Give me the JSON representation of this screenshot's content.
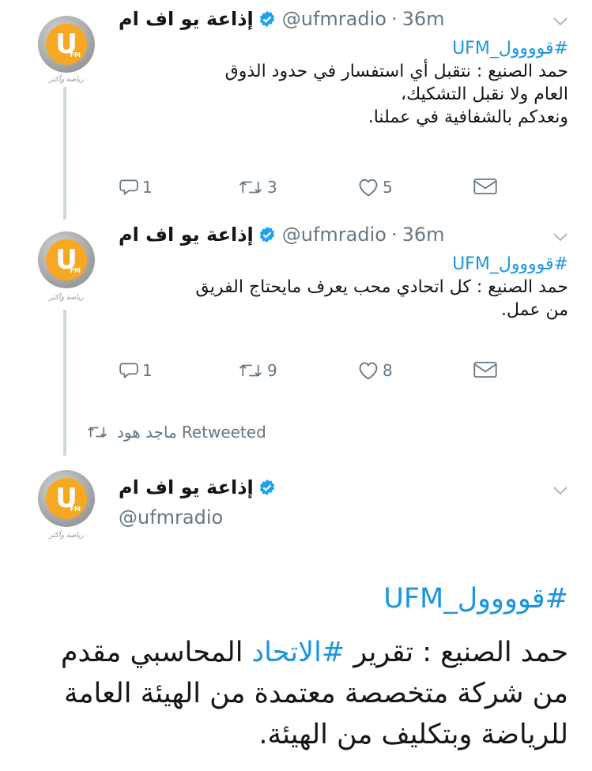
{
  "colors": {
    "accent": "#1b95e0",
    "text": "#14171a",
    "muted": "#657786",
    "line": "#ccd6dd",
    "logo": "#f7a823"
  },
  "account": {
    "name": "إذاعة يو اف ام",
    "handle": "@ufmradio",
    "avatar_letter": "U",
    "avatar_sub": "FM",
    "avatar_caption": "رياضة وأكثر"
  },
  "tweets": [
    {
      "time": "36m",
      "hashtag": "#قوووول_UFM",
      "lines": [
        "حمد الصنيع : نتقبل أي استفسار في حدود الذوق",
        "العام ولا نقبل التشكيك،",
        "ونعدكم بالشفافية في عملنا."
      ],
      "replies": "1",
      "retweets": "3",
      "likes": "5"
    },
    {
      "time": "36m",
      "hashtag": "#قوووول_UFM",
      "lines": [
        "حمد الصنيع : كل اتحادي محب يعرف مايحتاج الفريق",
        "من عمل."
      ],
      "replies": "1",
      "retweets": "9",
      "likes": "8"
    }
  ],
  "retweeted": {
    "label": "Retweeted",
    "by": "ماجد هود"
  },
  "expanded": {
    "hashtag": "#قوووول_UFM",
    "line1_before": "حمد الصنيع : تقرير ",
    "line1_hashtag": "#الاتحاد",
    "line1_after": " المحاسبي مقدم",
    "line2": "من شركة متخصصة معتمدة من الهيئة العامة",
    "line3": "للرياضة وبتكليف من الهيئة."
  },
  "icons": [
    "reply-icon",
    "retweet-icon",
    "like-icon",
    "message-icon",
    "chevron-down-icon",
    "verified-icon"
  ]
}
